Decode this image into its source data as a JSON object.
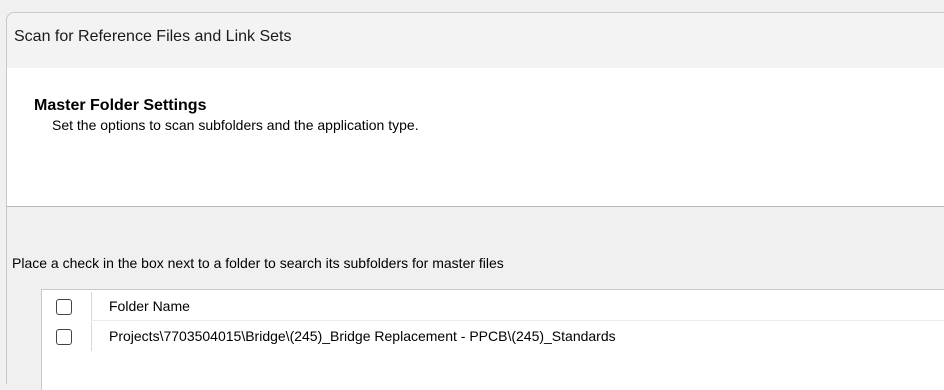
{
  "window": {
    "title": "Scan for Reference Files and Link Sets"
  },
  "header": {
    "heading": "Master Folder Settings",
    "subtitle": "Set the options to scan subfolders and the application type."
  },
  "body": {
    "instruction": "Place a check in the box next to a folder to search its subfolders for master files"
  },
  "grid": {
    "columns": [
      "Folder Name"
    ],
    "header_checked": false,
    "rows": [
      {
        "checked": false,
        "folder_name": "Projects\\7703504015\\Bridge\\(245)_Bridge Replacement - PPCB\\(245)_Standards"
      }
    ]
  }
}
